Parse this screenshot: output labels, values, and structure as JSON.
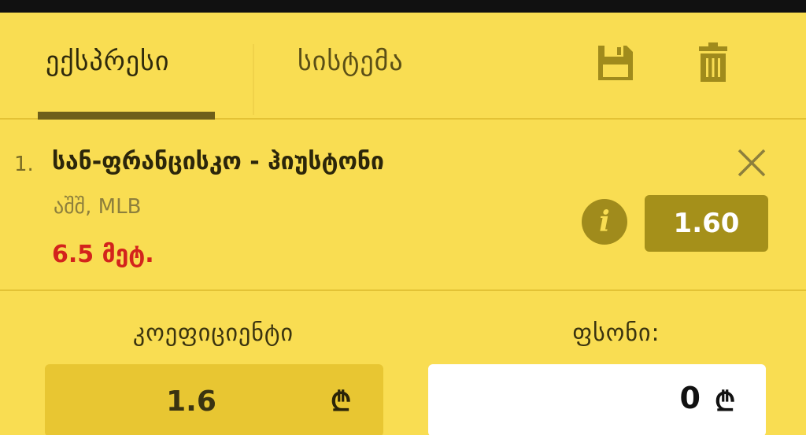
{
  "tabs": {
    "express": "ექსპრესი",
    "system": "სისტემა"
  },
  "bet": {
    "index": "1.",
    "title": "სან-ფრანცისკო - ჰიუსტონი",
    "league": "აშშ, MLB",
    "market": "6.5 მეტ.",
    "odd": "1.60",
    "info_symbol": "i"
  },
  "slip": {
    "coef_label": "კოეფიციენტი",
    "stake_label": "ფსონი:",
    "coef_value": "1.6",
    "stake_value": "0",
    "currency": "₾"
  },
  "icons": {
    "save": "save-icon",
    "trash": "trash-icon",
    "close": "close-icon",
    "info": "info-icon"
  },
  "colors": {
    "background": "#f9dd52",
    "accent_dark": "#a5901a",
    "market_red": "#d3231c"
  }
}
